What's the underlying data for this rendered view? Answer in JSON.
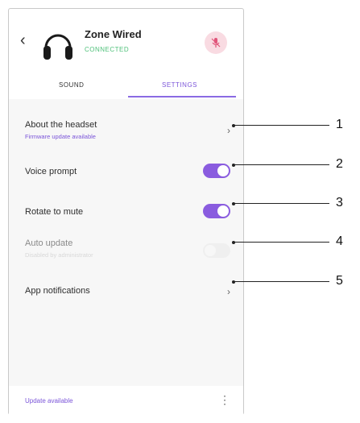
{
  "header": {
    "back_glyph": "‹",
    "device_name": "Zone Wired",
    "status": "CONNECTED"
  },
  "tabs": [
    {
      "label": "SOUND",
      "active": false
    },
    {
      "label": "SETTINGS",
      "active": true
    }
  ],
  "settings": {
    "about": {
      "label": "About the headset",
      "sub": "Firmware update available",
      "chevron": "›"
    },
    "voice_prompt": {
      "label": "Voice prompt",
      "on": true
    },
    "rotate_to_mute": {
      "label": "Rotate to mute",
      "on": true
    },
    "auto_update": {
      "label": "Auto update",
      "sub": "Disabled by administrator",
      "on": false
    },
    "app_notifications": {
      "label": "App notifications",
      "chevron": "›"
    }
  },
  "footer": {
    "update_text": "Update available",
    "more_glyph": "⋮"
  },
  "callouts": [
    "1",
    "2",
    "3",
    "4",
    "5"
  ],
  "colors": {
    "accent": "#8a5cdf",
    "connected": "#4fc17a",
    "mic_bg": "#f9dbe2",
    "mic_icon": "#e0557a"
  },
  "icons": {
    "back": "chevron-left-icon",
    "headset": "headset-icon",
    "mic_muted": "mic-muted-icon",
    "more": "more-vertical-icon"
  }
}
